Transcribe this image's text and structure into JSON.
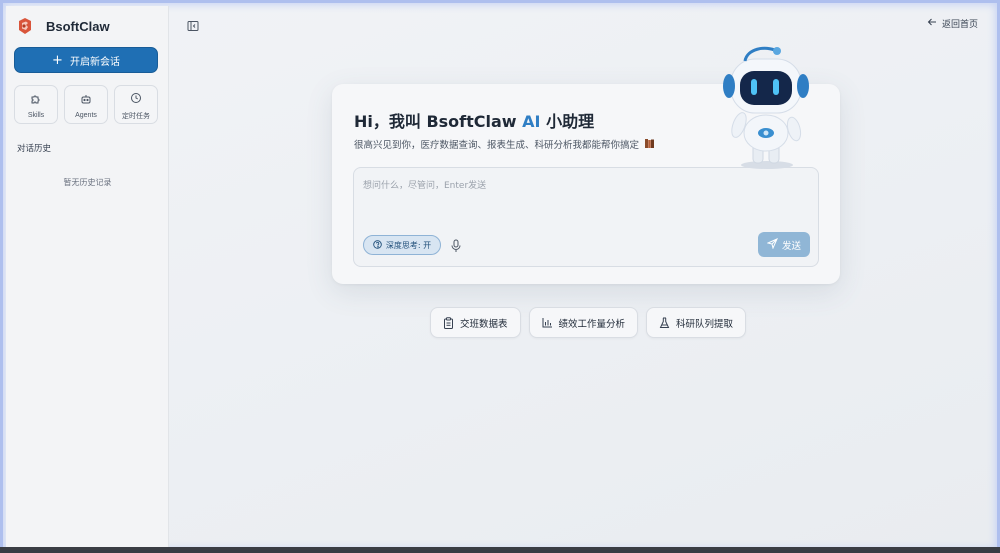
{
  "brand": {
    "name": "BsoftClaw"
  },
  "sidebar": {
    "new_chat_label": "开启新会话",
    "tools": [
      {
        "label": "Skills",
        "icon": "puzzle-icon"
      },
      {
        "label": "Agents",
        "icon": "robot-icon"
      },
      {
        "label": "定时任务",
        "icon": "clock-icon"
      }
    ],
    "history_title": "对话历史",
    "history_empty": "暂无历史记录"
  },
  "header": {
    "back_home_label": "返回首页"
  },
  "main": {
    "greeting_prefix": "Hi，我叫 BsoftClaw",
    "greeting_ai": "AI",
    "greeting_suffix": "小助理",
    "subtitle": "很高兴见到你，医疗数据查询、报表生成、科研分析我都能帮你搞定",
    "input_placeholder": "想问什么，尽管问，Enter发送",
    "deep_think_label": "深度思考: 开",
    "send_label": "发送"
  },
  "quick_actions": [
    {
      "label": "交班数据表",
      "icon": "clipboard-icon"
    },
    {
      "label": "绩效工作量分析",
      "icon": "bar-chart-icon"
    },
    {
      "label": "科研队列提取",
      "icon": "flask-icon"
    }
  ],
  "colors": {
    "accent": "#1f6fb4",
    "ai_text": "#2f7ec4",
    "send_button": "#90b6d6",
    "frame_border": "#aebfee"
  }
}
